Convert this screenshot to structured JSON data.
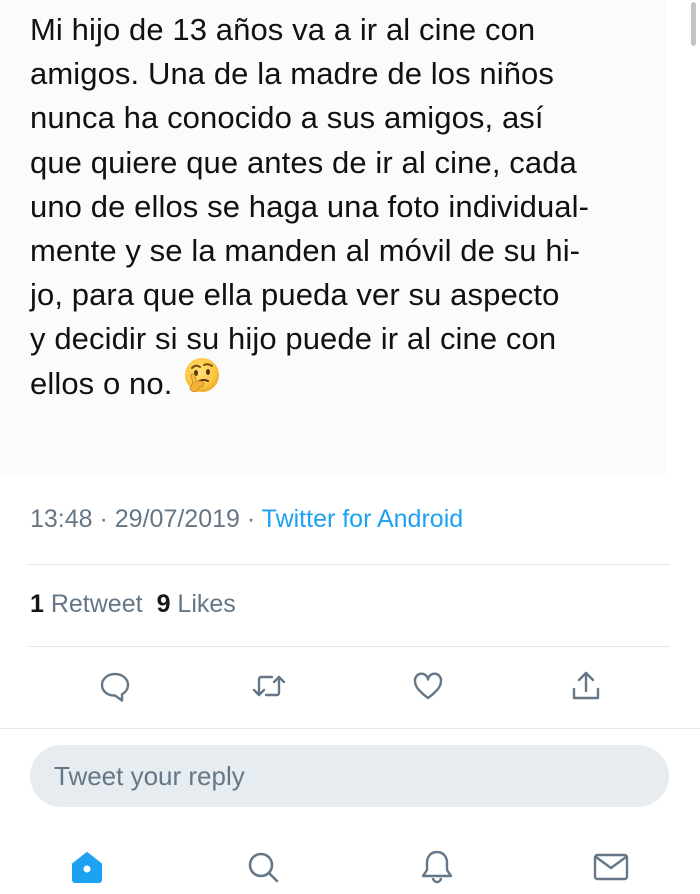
{
  "tweet": {
    "lines": [
      "Mi hijo de 13 años va a ir al cine con",
      "amigos. Una de la madre de los niños",
      "nunca ha conocido a sus amigos, así",
      "que quiere que antes de ir al cine, cada",
      "uno de ellos se haga una foto individual-",
      "mente y se la manden al móvil de su hi-",
      "jo, para que ella pueda ver su aspecto",
      "y decidir si su hijo puede ir al cine con",
      "ellos o no."
    ],
    "emoji": "thinking-face-icon"
  },
  "meta": {
    "time": "13:48",
    "separator1": " · ",
    "date": "29/07/2019",
    "separator2": " · ",
    "source": "Twitter for Android"
  },
  "stats": {
    "retweets_count": "1",
    "retweets_label": " Retweet",
    "likes_count": "9",
    "likes_label": " Likes"
  },
  "actions": [
    {
      "name": "reply-icon"
    },
    {
      "name": "retweet-icon"
    },
    {
      "name": "like-icon"
    },
    {
      "name": "share-icon"
    }
  ],
  "reply": {
    "placeholder": "Tweet your reply"
  },
  "nav": {
    "items": [
      "home-icon",
      "search-icon",
      "notifications-icon",
      "messages-icon"
    ]
  },
  "colors": {
    "accent": "#1da1f2",
    "muted": "#657786",
    "divider": "#e1e8ed",
    "reply_bg": "#e6ecf0"
  }
}
